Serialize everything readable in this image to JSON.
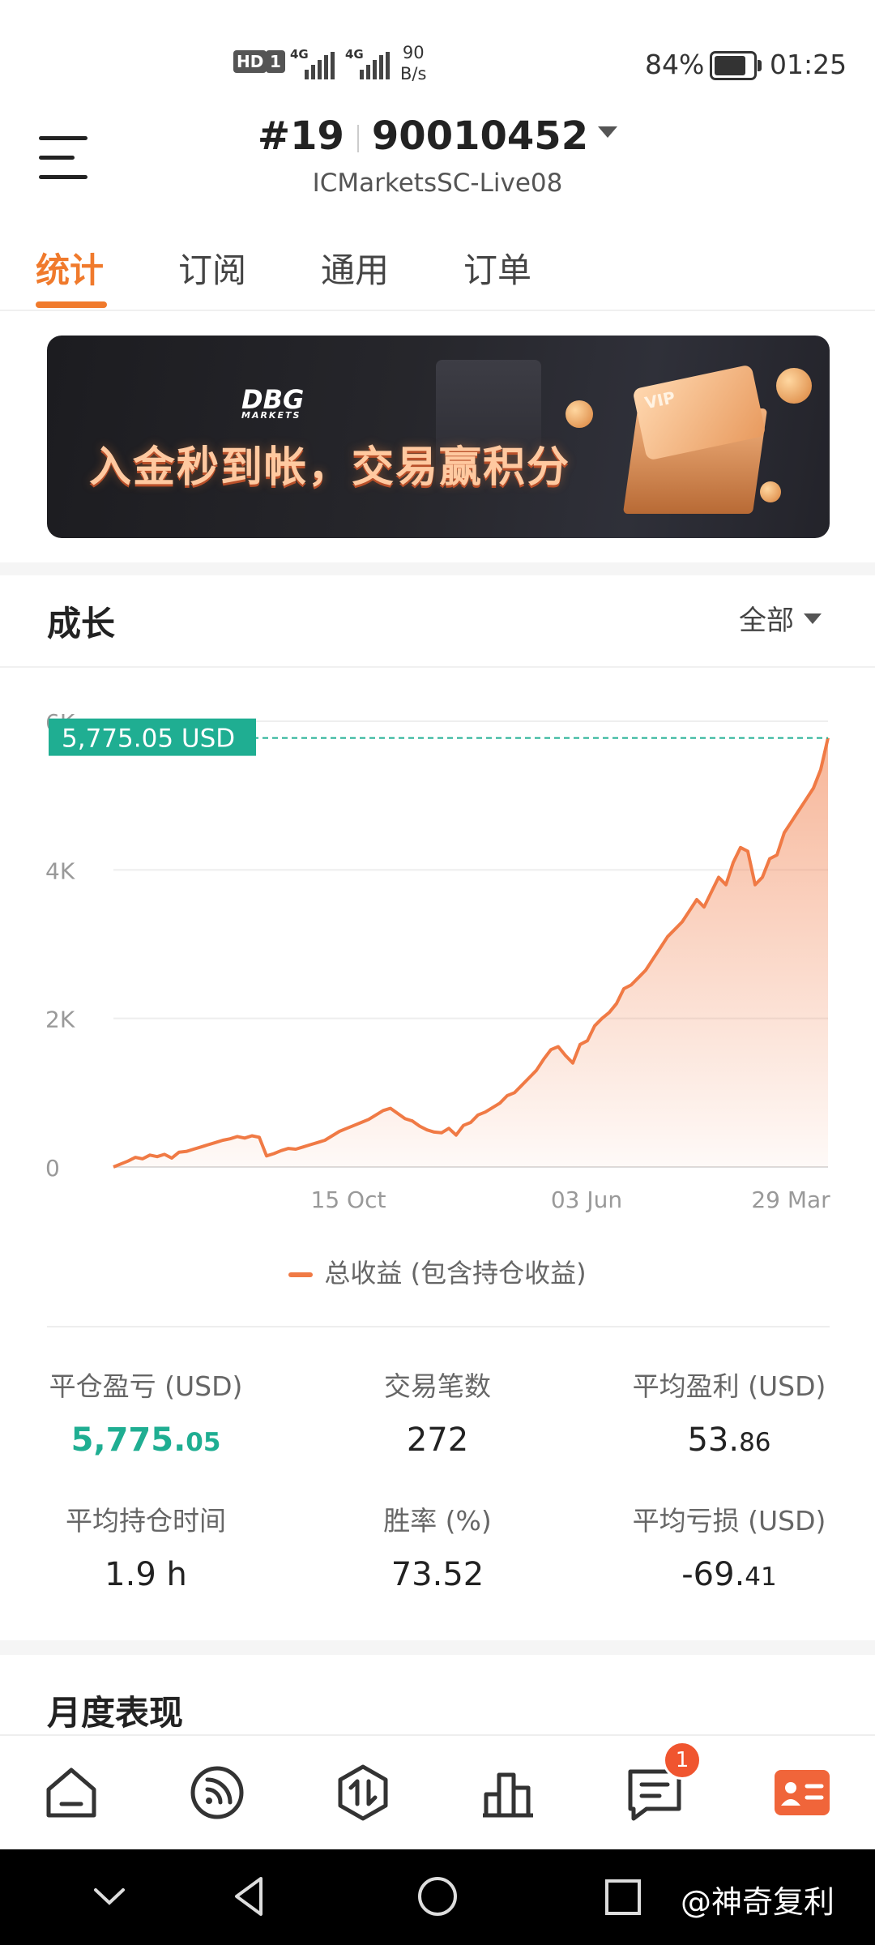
{
  "status_bar": {
    "hd": "HD",
    "sim": "1",
    "net1": "4G",
    "net2": "4G",
    "speed_value": "90",
    "speed_unit": "B/s",
    "battery": "84%",
    "time": "01:25"
  },
  "header": {
    "account_rank": "#19",
    "account_number": "90010452",
    "server": "ICMarketsSC-Live08"
  },
  "tabs": [
    {
      "label": "统计",
      "active": true
    },
    {
      "label": "订阅",
      "active": false
    },
    {
      "label": "通用",
      "active": false
    },
    {
      "label": "订单",
      "active": false
    }
  ],
  "banner": {
    "logo": "DBG",
    "logo_sub": "MARKETS",
    "headline": "入金秒到帐，交易赢积分",
    "vip": "VIP"
  },
  "growth": {
    "title": "成长",
    "range": "全部"
  },
  "chart_data": {
    "type": "area",
    "x_ticks": [
      "15 Oct",
      "03 Jun",
      "29 Mar"
    ],
    "y_ticks": [
      "0",
      "2K",
      "4K",
      "6K"
    ],
    "ylim": [
      0,
      6000
    ],
    "current_label": "5,775.05 USD",
    "current_value": 5775.05,
    "accent": "#f07a45",
    "series": [
      {
        "name": "总收益 (包含持仓收益)",
        "values": [
          0,
          40,
          80,
          130,
          110,
          160,
          140,
          170,
          120,
          200,
          210,
          240,
          270,
          300,
          330,
          360,
          380,
          410,
          390,
          420,
          400,
          150,
          180,
          220,
          250,
          240,
          270,
          300,
          330,
          360,
          420,
          480,
          520,
          560,
          600,
          640,
          700,
          760,
          790,
          720,
          650,
          620,
          550,
          500,
          470,
          460,
          520,
          430,
          560,
          600,
          700,
          740,
          800,
          860,
          960,
          1000,
          1100,
          1200,
          1300,
          1450,
          1580,
          1620,
          1500,
          1400,
          1650,
          1700,
          1900,
          2000,
          2080,
          2200,
          2400,
          2450,
          2550,
          2650,
          2800,
          2950,
          3100,
          3200,
          3300,
          3450,
          3600,
          3500,
          3700,
          3900,
          3800,
          4100,
          4300,
          4250,
          3800,
          3900,
          4150,
          4200,
          4500,
          4650,
          4800,
          4950,
          5100,
          5350,
          5775.05
        ]
      }
    ]
  },
  "legend": {
    "label": "总收益 (包含持仓收益)"
  },
  "stats": [
    {
      "label": "平仓盈亏 (USD)",
      "value_main": "5,775.",
      "value_small": "05",
      "style": "green"
    },
    {
      "label": "交易笔数",
      "value_main": "272",
      "value_small": "",
      "style": "plain"
    },
    {
      "label": "平均盈利 (USD)",
      "value_main": "53.",
      "value_small": "86",
      "style": "plain"
    },
    {
      "label": "平均持仓时间",
      "value_main": "1.9 h",
      "value_small": "",
      "style": "plain"
    },
    {
      "label": "胜率 (%)",
      "value_main": "73.52",
      "value_small": "",
      "style": "plain"
    },
    {
      "label": "平均亏损 (USD)",
      "value_main": "-69.",
      "value_small": "41",
      "style": "plain"
    }
  ],
  "monthly": {
    "title": "月度表现"
  },
  "bottom_nav": {
    "messages_badge": "1",
    "active_color": "#f0653a"
  },
  "watermark": "@神奇复利"
}
